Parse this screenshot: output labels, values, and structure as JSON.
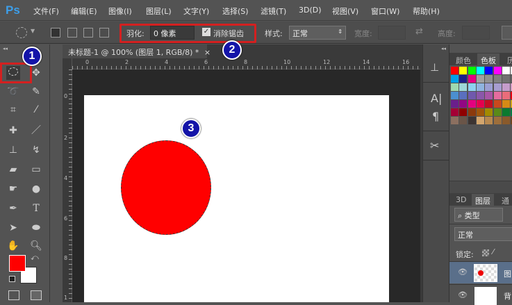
{
  "app": {
    "logo": "Ps"
  },
  "menu": [
    "文件(F)",
    "编辑(E)",
    "图像(I)",
    "图层(L)",
    "文字(Y)",
    "选择(S)",
    "滤镜(T)",
    "3D(D)",
    "视图(V)",
    "窗口(W)",
    "帮助(H)"
  ],
  "options": {
    "feather_label": "羽化:",
    "feather_value": "0 像素",
    "antialias_label": "消除锯齿",
    "antialias_checked": true,
    "style_label": "样式:",
    "style_value": "正常",
    "width_label": "宽度:",
    "height_label": "高度:"
  },
  "document": {
    "tab_title": "未标题-1 @ 100% (图层 1, RGB/8) *",
    "close": "×",
    "fill_color": "#ff0000"
  },
  "rulers": {
    "h": [
      "0",
      "2",
      "4",
      "6",
      "8",
      "10",
      "12",
      "14",
      "16"
    ],
    "v": [
      "0",
      "2",
      "4",
      "6",
      "8",
      "1"
    ]
  },
  "badges": [
    "1",
    "2",
    "3"
  ],
  "panel": {
    "tabs_top": [
      "颜色",
      "色板",
      "历"
    ],
    "tabs_layers": [
      "3D",
      "图层",
      "通"
    ],
    "filter": "类型",
    "blend": "正常",
    "lock_label": "锁定:",
    "layers": [
      {
        "name": "图"
      },
      {
        "name": "背"
      }
    ]
  },
  "swatches": [
    [
      "#ff0000",
      "#ffff00",
      "#00ff00",
      "#00ffff",
      "#0000ff",
      "#ff00ff",
      "#ffffff",
      "#eeeeee"
    ],
    [
      "#00a0e9",
      "#1d2088",
      "#e4007f",
      "#a0a0a0",
      "#909090",
      "#808080",
      "#707070",
      "#606060"
    ],
    [
      "#9fd9b0",
      "#9ed6d8",
      "#8fd0ef",
      "#8fb4e0",
      "#9b9fd3",
      "#a79dd0",
      "#c59ccb",
      "#d29bc5"
    ],
    [
      "#4b8fd0",
      "#5a6fbf",
      "#7059ad",
      "#8b57aa",
      "#a856a6",
      "#e56c9e",
      "#ea6c7a",
      "#e60012"
    ],
    [
      "#6a1f8c",
      "#920783",
      "#e4007f",
      "#e5004f",
      "#c30d23",
      "#c9491d",
      "#d68a16",
      "#d1a41a"
    ],
    [
      "#a40035",
      "#8f0000",
      "#8b3a0c",
      "#a0560b",
      "#a38b00",
      "#5a8a18",
      "#0a7a2f",
      "#007b44"
    ],
    [
      "#8c7060",
      "#6a5548",
      "#3c3432",
      "#d3a66e",
      "#b8894f",
      "#9e6f3b",
      "#8a5a2b",
      "#6e4520"
    ]
  ],
  "colors": {
    "accent": "#d42020",
    "badge": "#1414a8",
    "foreground": "#ff0000",
    "background": "#ffffff"
  }
}
